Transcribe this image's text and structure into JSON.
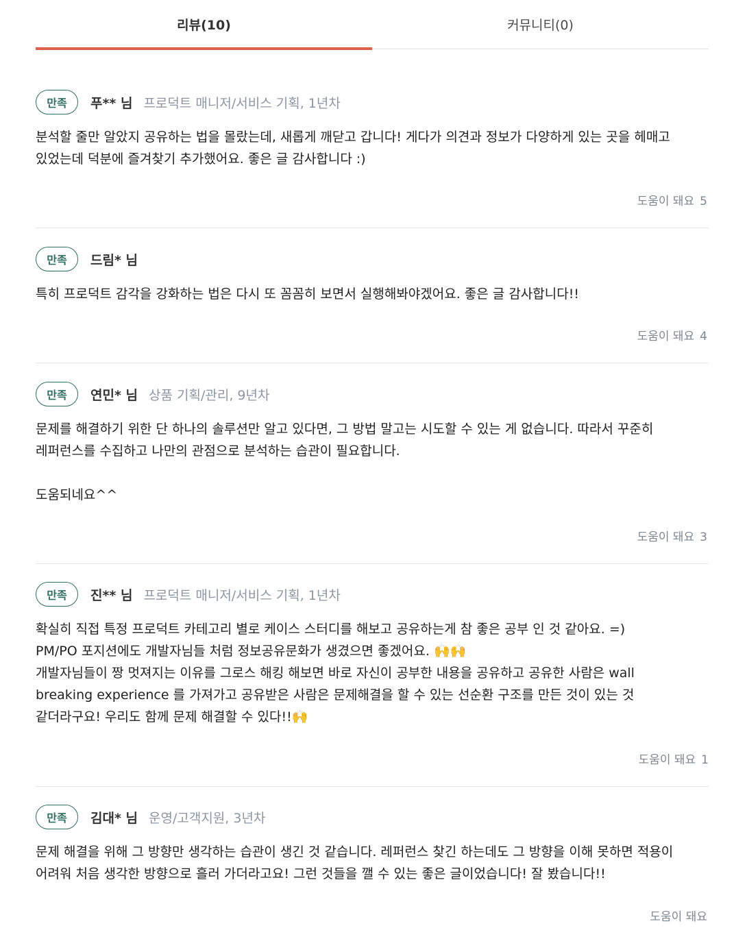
{
  "tabs": [
    {
      "label": "리뷰(10)",
      "active": true
    },
    {
      "label": "커뮤니티(0)",
      "active": false
    }
  ],
  "accent_color": "#e0604e",
  "badge_color": "#2f6e62",
  "helpful_label": "도움이 돼요",
  "reviews": [
    {
      "badge": "만족",
      "author": "푸** 님",
      "job": "프로덕트 매니저/서비스 기획, 1년차",
      "text": "분석할 줄만 알았지 공유하는 법을 몰랐는데, 새롭게 깨닫고 갑니다! 게다가 의견과 정보가 다양하게 있는 곳을 헤매고\n있었는데 덕분에 즐겨찾기 추가했어요. 좋은 글 감사합니다 :)",
      "helpful_count": "5"
    },
    {
      "badge": "만족",
      "author": "드림* 님",
      "job": "",
      "text": "특히 프로덕트 감각을 강화하는 법은 다시 또 꼼꼼히 보면서 실행해봐야겠어요. 좋은 글 감사합니다!!",
      "helpful_count": "4"
    },
    {
      "badge": "만족",
      "author": "연민* 님",
      "job": "상품 기획/관리, 9년차",
      "text": "문제를 해결하기 위한 단 하나의 솔루션만 알고 있다면, 그 방법 말고는 시도할 수 있는 게 없습니다. 따라서 꾸준히\n레퍼런스를 수집하고 나만의 관점으로 분석하는 습관이 필요합니다.\n\n도움되네요^^",
      "helpful_count": "3"
    },
    {
      "badge": "만족",
      "author": "진** 님",
      "job": "프로덕트 매니저/서비스 기획, 1년차",
      "text": "확실히 직접 특정 프로덕트 카테고리 별로 케이스 스터디를 해보고 공유하는게 참 좋은 공부 인 것 같아요. =)\nPM/PO 포지션에도 개발자님들 처럼 정보공유문화가 생겼으면 좋겠어요. 🙌🙌\n개발자님들이 짱 멋져지는 이유를 그로스 해킹 해보면 바로 자신이 공부한 내용을 공유하고 공유한 사람은 wall\nbreaking experience 를 가져가고 공유받은 사람은 문제해결을 할 수 있는 선순환 구조를 만든 것이 있는 것\n같더라구요! 우리도 함께 문제 해결할 수 있다!!🙌",
      "helpful_count": "1"
    },
    {
      "badge": "만족",
      "author": "김대* 님",
      "job": "운영/고객지원, 3년차",
      "text": "문제 해결을 위해 그 방향만 생각하는 습관이 생긴 것 같습니다. 레퍼런스 찾긴 하는데도 그 방향을 이해 못하면 적용이\n어려워 처음 생각한 방향으로 흘러 가더라고요! 그런 것들을 깰 수 있는 좋은 글이었습니다! 잘 봤습니다!!",
      "helpful_count": ""
    }
  ]
}
